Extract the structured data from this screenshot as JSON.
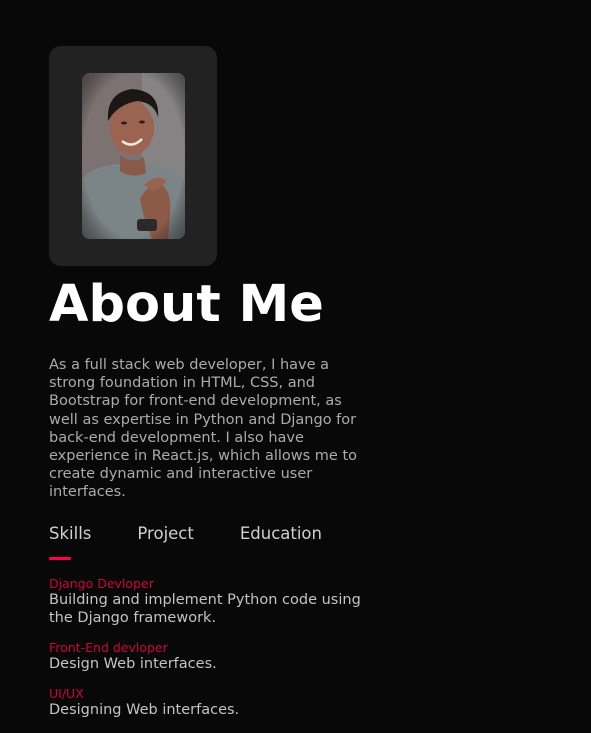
{
  "about": {
    "title": "About Me",
    "intro": "As a full stack web developer, I have a strong foundation in HTML, CSS, and Bootstrap for front-end development, as well as expertise in Python and Django for back-end development. I also have experience in React.js, which allows me to create dynamic and interactive user interfaces."
  },
  "tabs": [
    {
      "label": "Skills",
      "active": true
    },
    {
      "label": "Project",
      "active": false
    },
    {
      "label": "Education",
      "active": false
    }
  ],
  "skills": [
    {
      "name": "Django Devloper",
      "desc": "Building and implement Python code using the Django framework."
    },
    {
      "name": "Front-End devloper",
      "desc": "Design Web interfaces."
    },
    {
      "name": "UI/UX",
      "desc": "Designing Web interfaces."
    }
  ],
  "colors": {
    "background": "#080808",
    "accent": "#ff004f",
    "card": "#222222",
    "text": "#ababab",
    "heading": "#ffffff"
  }
}
